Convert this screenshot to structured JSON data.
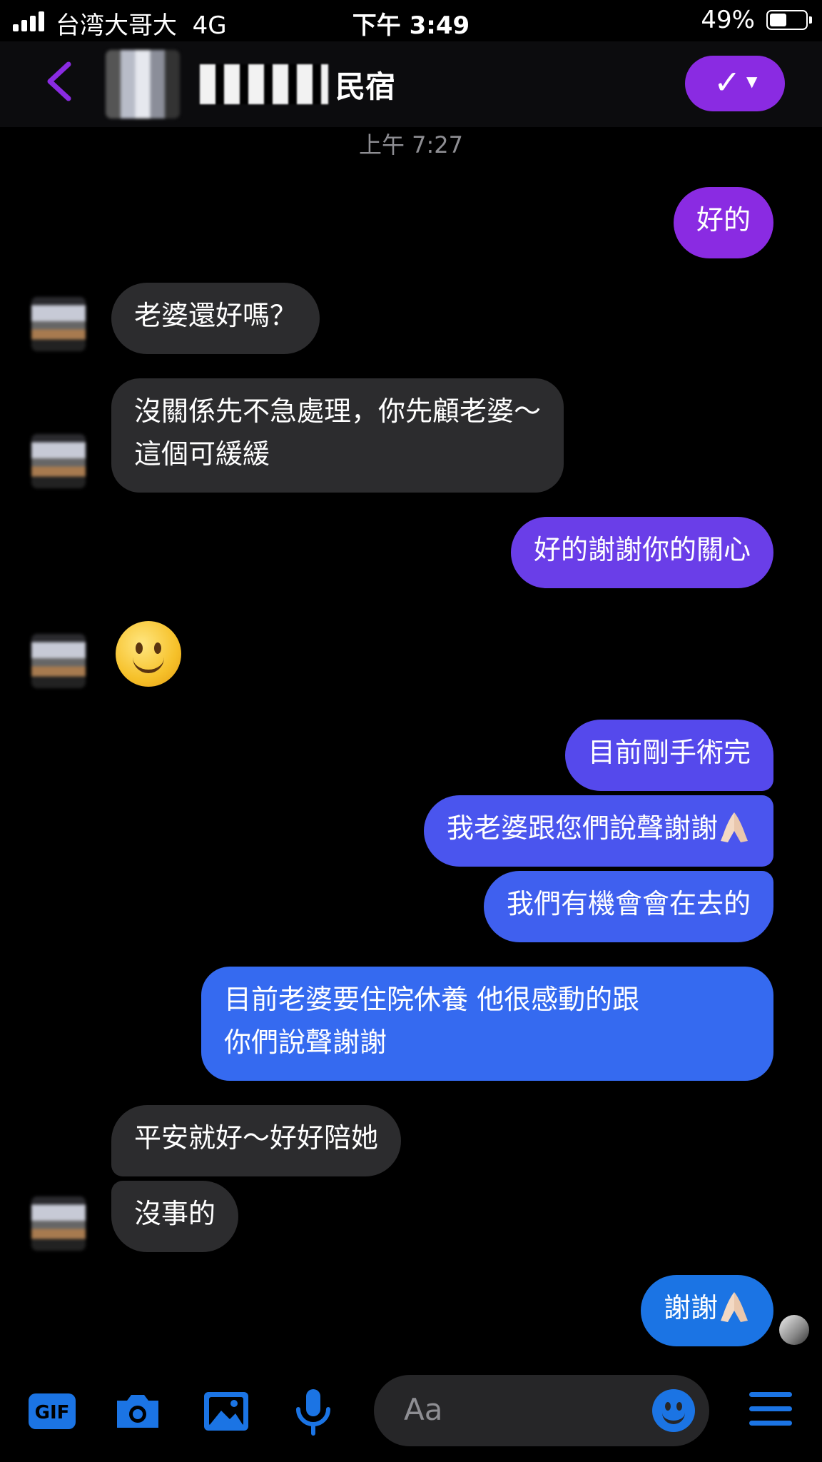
{
  "status_bar": {
    "carrier": "台湾大哥大",
    "network": "4G",
    "time": "下午 3:49",
    "battery_percent": "49%",
    "battery_level": 0.49
  },
  "header": {
    "contact_name": "民宿",
    "call_icon": "check-icon"
  },
  "messages": {
    "timestamp": "上午 7:27",
    "m1": "好的",
    "m2": "老婆還好嗎？",
    "m3_line1": "沒關係先不急處理，你先顧老婆～",
    "m3_line2": "這個可緩緩",
    "m4": "好的謝謝你的關心",
    "m5_emoji": "slightly-smiling-face",
    "m6": "目前剛手術完",
    "m7": "我老婆跟您們說聲謝謝",
    "m8": "我們有機會會在去的",
    "m9_line1": "目前老婆要住院休養 他很感動的跟",
    "m9_line2": "你們說聲謝謝",
    "m10": "平安就好～好好陪她",
    "m11": "沒事的",
    "m12": "謝謝"
  },
  "composer": {
    "placeholder": "Aa"
  },
  "colors": {
    "accent": "#8a2be2",
    "outgoing_top": "#7b3fe4",
    "outgoing_bottom": "#1b74e4",
    "incoming": "#2c2c2e",
    "icon_blue": "#1b74e4"
  }
}
